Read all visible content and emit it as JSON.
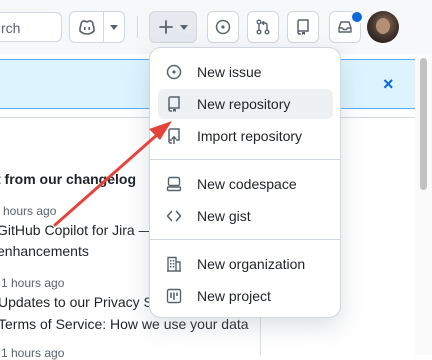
{
  "header": {
    "search_text": "rch"
  },
  "banner": {
    "close_symbol": "×"
  },
  "feed": {
    "title": "t from our changelog",
    "items": [
      {
        "time": "hours ago",
        "line1": "GitHub Copilot for Jira —",
        "line2": "enhancements"
      },
      {
        "time": "1 hours ago",
        "line1": "Updates to our Privacy St",
        "line2": "Terms of Service: How we use your data"
      },
      {
        "time": "1 hours ago"
      }
    ]
  },
  "create_menu": {
    "items": [
      {
        "label": "New issue",
        "icon": "issue-opened-icon"
      },
      {
        "label": "New repository",
        "icon": "repo-icon",
        "highlighted": true
      },
      {
        "label": "Import repository",
        "icon": "repo-push-icon"
      },
      {
        "label": "New codespace",
        "icon": "codespaces-icon"
      },
      {
        "label": "New gist",
        "icon": "code-icon"
      },
      {
        "label": "New organization",
        "icon": "organization-icon"
      },
      {
        "label": "New project",
        "icon": "project-icon"
      }
    ]
  },
  "colors": {
    "accent": "#0969da",
    "annotation_arrow": "#e5443c",
    "banner_bg": "#ddf4ff"
  }
}
